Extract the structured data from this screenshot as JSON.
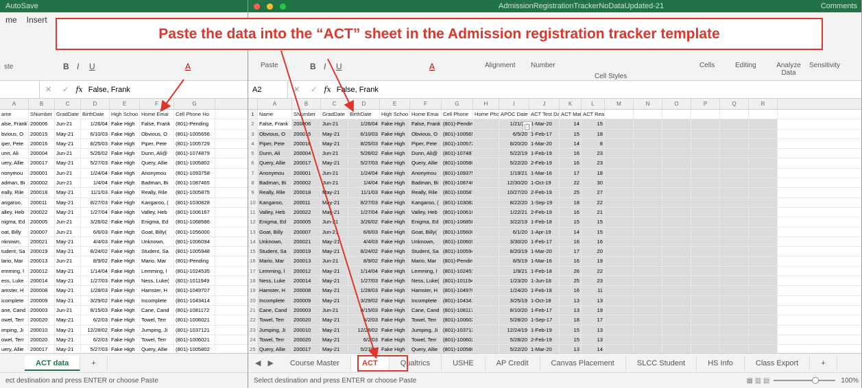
{
  "banner": "Paste the data into the “ACT” sheet in the Admission registration tracker template",
  "left": {
    "title": "AutoSave",
    "ribbon_tabs": [
      "me",
      "Insert"
    ],
    "paste_label": "ste",
    "name_box": "",
    "formula": "False, Frank",
    "columns": [
      "A",
      "B",
      "C",
      "D",
      "E",
      "F",
      "G"
    ],
    "headers": [
      "ame",
      "SNumber",
      "GradDate",
      "BirthDate",
      "High Schoo",
      "Home Emai",
      "Cell Phone Ho"
    ],
    "rows": [
      [
        "alse, Frank",
        "200006",
        "Jun-21",
        "1/26/04",
        "Fake High",
        "False, Frank",
        "(801)-Pending"
      ],
      [
        "bvious, O",
        "200015",
        "May-21",
        "6/10/03",
        "Fake High",
        "Obvious, O",
        "(801)-1005656"
      ],
      [
        "iper, Pete",
        "200016",
        "May-21",
        "8/25/03",
        "Fake High",
        "Piper, Pete",
        "(801)-1005729"
      ],
      [
        "unn, Ali",
        "200004",
        "Jun-21",
        "5/26/02",
        "Fake High",
        "Dunn, Ali@",
        "(801)-1074879"
      ],
      [
        "uery, Allie",
        "200017",
        "May-21",
        "5/27/03",
        "Fake High",
        "Query, Allie",
        "(801)-1005802"
      ],
      [
        "nonymou",
        "200001",
        "Jun-21",
        "1/24/04",
        "Fake High",
        "Anonymou",
        "(801)-1093758"
      ],
      [
        "adman, Bi",
        "200002",
        "Jun-21",
        "1/4/04",
        "Fake High",
        "Badman, Bi",
        "(801)-1087465"
      ],
      [
        "eally, Rile",
        "200018",
        "May-21",
        "11/1/03",
        "Fake High",
        "Really, Rile",
        "(801)-1005875"
      ],
      [
        "angaroo,",
        "200011",
        "May-21",
        "8/27/03",
        "Fake High",
        "Kangaroo, (",
        "(801)-1030828"
      ],
      [
        "alley, Heb",
        "200022",
        "May-21",
        "1/27/04",
        "Fake High",
        "Valley, Heb",
        "(801)-1006167"
      ],
      [
        "nigma, Ed",
        "200005",
        "Jun-21",
        "3/26/02",
        "Fake High",
        "Enigma, Ed",
        "(801)-1068586"
      ],
      [
        "oat, Billy",
        "200007",
        "Jun-21",
        "6/6/03",
        "Fake High",
        "Goat, Billy(",
        "(801)-1056000"
      ],
      [
        "nknown,",
        "200021",
        "May-21",
        "4/4/03",
        "Fake High",
        "Unknown,",
        "(801)-1006094"
      ],
      [
        "tudent, Sa",
        "200019",
        "May-21",
        "8/24/02",
        "Fake High",
        "Student, Sa",
        "(801)-1005948"
      ],
      [
        "lario, Mar",
        "200013",
        "Jun-21",
        "8/9/02",
        "Fake High",
        "Mario, Mar",
        "(801)-Pending"
      ],
      [
        "emming, l",
        "200012",
        "May-21",
        "1/14/04",
        "Fake High",
        "Lemming, l",
        "(801)-1024535"
      ],
      [
        "ess, Luke",
        "200014",
        "May-21",
        "1/27/03",
        "Fake High",
        "Ness, Luke(",
        "(801)-1011949"
      ],
      [
        "amster, H",
        "200008",
        "May-21",
        "1/28/03",
        "Fake High",
        "Hamster, H",
        "(801)-1049707"
      ],
      [
        "icomplete",
        "200009",
        "May-21",
        "3/29/02",
        "Fake High",
        "Incomplete",
        "(801)-1043414"
      ],
      [
        "ane, Cand",
        "200003",
        "Jun-21",
        "8/15/03",
        "Fake High",
        "Cane, Cand",
        "(801)-1081172"
      ],
      [
        "owel, Terr",
        "200020",
        "May-21",
        "6/2/03",
        "Fake High",
        "Towel, Terr",
        "(801)-1006021"
      ],
      [
        "imping, Ji",
        "200010",
        "May-21",
        "12/28/02",
        "Fake High",
        "Jumping, Ji",
        "(801)-1037121"
      ],
      [
        "owel, Terr",
        "200020",
        "May-21",
        "6/2/03",
        "Fake High",
        "Towel, Terr",
        "(801)-1006021"
      ],
      [
        "uery, Allie",
        "200017",
        "May-21",
        "5/27/03",
        "Fake High",
        "Query, Allie",
        "(801)-1005802"
      ],
      [
        "udent, Sa",
        "200019",
        "May-21",
        "8/24/02",
        "Fake High",
        "Student, Sa",
        "(801)-1005948"
      ]
    ],
    "sheet_tab": "ACT data",
    "add_tab": "+",
    "status": "ect destination and press ENTER or choose Paste"
  },
  "right": {
    "title": "AdmissionRegistrationTrackerNoDataUpdated-21",
    "ribbon_labels": [
      "Paste",
      "Alignment",
      "Number",
      "Cell Styles",
      "Cells",
      "Editing",
      "Analyze Data",
      "Sensitivity"
    ],
    "comments": "Comments",
    "name_box": "A2",
    "formula": "False, Frank",
    "columns": [
      "A",
      "B",
      "C",
      "D",
      "E",
      "F",
      "G",
      "H",
      "I",
      "J",
      "K",
      "L",
      "M",
      "N",
      "O",
      "P",
      "Q",
      "R"
    ],
    "headers": [
      "Name",
      "SNumber",
      "GradDate",
      "BirthDate",
      "High Schoo",
      "Home Emai",
      "Cell Phone",
      "Home Phor",
      "APOC Date",
      "ACT Test Da",
      "ACT Math",
      "ACT Reading"
    ],
    "rows": [
      [
        "False, Frank",
        "200006",
        "Jun-21",
        "1/26/04",
        "Fake High",
        "False, Frank",
        "(801)-Pending",
        "",
        "1/21/21",
        "1-Mar-20",
        "14",
        "15"
      ],
      [
        "Obvious, O",
        "200015",
        "May-21",
        "6/10/03",
        "Fake High",
        "Obvious, O",
        "(801)-1005656",
        "",
        "6/5/20",
        "1-Feb-17",
        "15",
        "18"
      ],
      [
        "Piper, Pete",
        "200016",
        "May-21",
        "8/25/03",
        "Fake High",
        "Piper, Pete",
        "(801)-1005729",
        "",
        "8/20/20",
        "1-Mar-20",
        "14",
        "8"
      ],
      [
        "Dunn, Ali",
        "200004",
        "Jun-21",
        "5/26/02",
        "Fake High",
        "Dunn, Ali@",
        "(801)-1074879",
        "",
        "5/22/19",
        "1-Feb-19",
        "16",
        "23"
      ],
      [
        "Query, Allie",
        "200017",
        "May-21",
        "5/27/03",
        "Fake High",
        "Query, Allie",
        "(801)-1005802",
        "",
        "5/22/20",
        "2-Feb-19",
        "16",
        "23"
      ],
      [
        "Anonymou",
        "200001",
        "Jun-21",
        "1/24/04",
        "Fake High",
        "Anonymou",
        "(801)-1093758",
        "",
        "1/19/21",
        "1-Mar-16",
        "17",
        "18"
      ],
      [
        "Badman, Bi",
        "200002",
        "Jun-21",
        "1/4/04",
        "Fake High",
        "Badman, Bi",
        "(801)-1087465",
        "",
        "12/30/20",
        "1-Oct-19",
        "22",
        "30"
      ],
      [
        "Really, Rile",
        "200018",
        "May-21",
        "11/1/03",
        "Fake High",
        "Really, Rile",
        "(801)-1005875",
        "",
        "10/27/20",
        "2-Feb-19",
        "25",
        "27"
      ],
      [
        "Kangaroo,",
        "200011",
        "May-21",
        "8/27/03",
        "Fake High",
        "Kangaroo, (",
        "(801)-1030828",
        "",
        "8/22/20",
        "1-Sep-19",
        "18",
        "22"
      ],
      [
        "Valley, Heb",
        "200022",
        "May-21",
        "1/27/04",
        "Fake High",
        "Valley, Heb",
        "(801)-1006167",
        "",
        "1/22/21",
        "2-Feb-19",
        "16",
        "21"
      ],
      [
        "Enigma, Ed",
        "200005",
        "Jun-21",
        "3/26/02",
        "Fake High",
        "Enigma, Ed",
        "(801)-1068586",
        "",
        "3/22/19",
        "1-Feb-18",
        "15",
        "15"
      ],
      [
        "Goat, Billy",
        "200007",
        "Jun-21",
        "6/6/03",
        "Fake High",
        "Goat, Billy(",
        "(801)-1056000",
        "",
        "6/1/20",
        "1-Apr-19",
        "14",
        "15"
      ],
      [
        "Unknown,",
        "200021",
        "May-21",
        "4/4/03",
        "Fake High",
        "Unknown,",
        "(801)-1006094",
        "",
        "3/30/20",
        "1-Feb-17",
        "16",
        "16"
      ],
      [
        "Student, Sa",
        "200019",
        "May-21",
        "8/24/02",
        "Fake High",
        "Student, Sa",
        "(801)-1005948",
        "",
        "8/20/19",
        "1-Mar-20",
        "17",
        "20"
      ],
      [
        "Mario, Mar",
        "200013",
        "Jun-21",
        "8/9/02",
        "Fake High",
        "Mario, Mar",
        "(801)-Pending",
        "",
        "8/5/19",
        "1-Mar-16",
        "16",
        "19"
      ],
      [
        "Lemming, l",
        "200012",
        "May-21",
        "1/14/04",
        "Fake High",
        "Lemming, l",
        "(801)-1024535",
        "",
        "1/9/21",
        "1-Feb-18",
        "26",
        "22"
      ],
      [
        "Ness, Luke",
        "200014",
        "May-21",
        "1/27/03",
        "Fake High",
        "Ness, Luke(",
        "(801)-1011949",
        "",
        "1/23/20",
        "1-Jun-18",
        "25",
        "23"
      ],
      [
        "Hamster, H",
        "200008",
        "May-21",
        "1/28/03",
        "Fake High",
        "Hamster, H",
        "(801)-1049707",
        "",
        "1/24/20",
        "1-Feb-18",
        "16",
        "11"
      ],
      [
        "Incomplete",
        "200009",
        "May-21",
        "3/29/02",
        "Fake High",
        "Incomplete",
        "(801)-1043414",
        "",
        "3/25/19",
        "1-Oct-18",
        "13",
        "13"
      ],
      [
        "Cane, Cand",
        "200003",
        "Jun-21",
        "8/15/03",
        "Fake High",
        "Cane, Cand",
        "(801)-1081172",
        "",
        "8/10/20",
        "1-Feb-17",
        "13",
        "19"
      ],
      [
        "Towel, Terr",
        "200020",
        "May-21",
        "6/2/03",
        "Fake High",
        "Towel, Terr",
        "(801)-1006021",
        "",
        "5/28/20",
        "1-Sep-17",
        "18",
        "17"
      ],
      [
        "Jumping, Ji",
        "200010",
        "May-21",
        "12/28/02",
        "Fake High",
        "Jumping, Ji",
        "(801)-1037121",
        "",
        "12/24/19",
        "1-Feb-19",
        "15",
        "13"
      ],
      [
        "Towel, Terr",
        "200020",
        "May-21",
        "6/2/03",
        "Fake High",
        "Towel, Terr",
        "(801)-1006021",
        "",
        "5/28/20",
        "2-Feb-19",
        "15",
        "13"
      ],
      [
        "Query, Allie",
        "200017",
        "May-21",
        "5/27/03",
        "Fake High",
        "Query, Allie",
        "(801)-1005802",
        "",
        "5/22/20",
        "1-Mar-20",
        "13",
        "14"
      ],
      [
        "Student, Sa",
        "200019",
        "May-21",
        "8/24/02",
        "Fake High",
        "Student, Sa",
        "(801)-1005948",
        "",
        "8/20/19",
        "1-Feb-18",
        "16",
        "18"
      ]
    ],
    "sheet_tabs": [
      "Course Master",
      "ACT",
      "Qualtrics",
      "USHE",
      "AP Credit",
      "Canvas Placement",
      "SLCC Student",
      "HS Info",
      "Class Export"
    ],
    "active_tab": "ACT",
    "add_tab": "+",
    "status": "Select destination and press ENTER or choose Paste",
    "zoom": "100%"
  },
  "colors": {
    "accent": "#e0352b",
    "excel_green": "#217346"
  }
}
